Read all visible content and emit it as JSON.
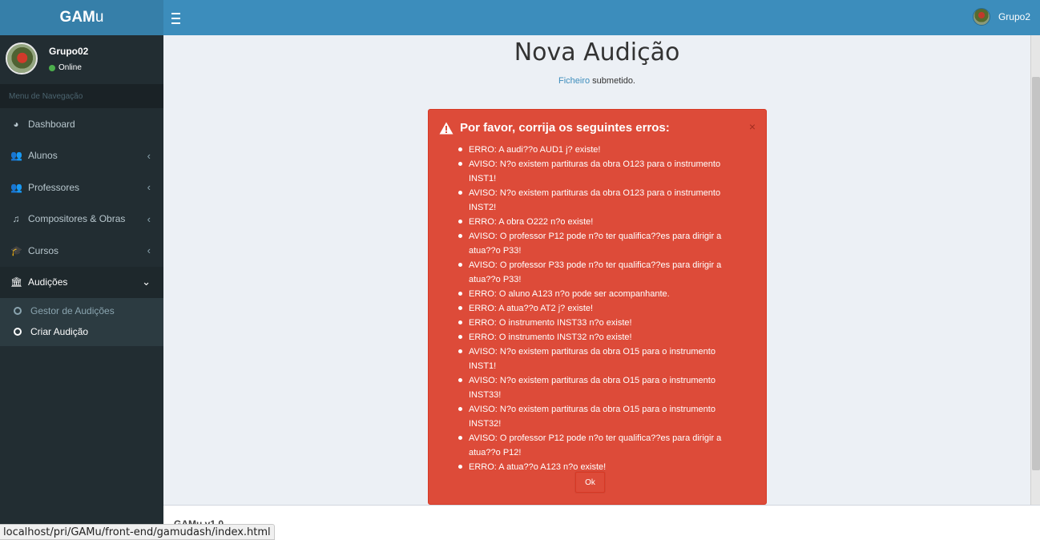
{
  "header": {
    "logo_bold": "GAM",
    "logo_light": "u",
    "user_name": "Grupo2"
  },
  "sidebar": {
    "user_name": "Grupo02",
    "user_status": "Online",
    "nav_header": "Menu de Navegação",
    "items": [
      {
        "label": "Dashboard",
        "icon": "dashboard-icon",
        "glyph": "◕"
      },
      {
        "label": "Alunos",
        "icon": "users-icon",
        "glyph": "👥"
      },
      {
        "label": "Professores",
        "icon": "users-icon",
        "glyph": "👥"
      },
      {
        "label": "Compositores & Obras",
        "icon": "music-icon",
        "glyph": "♫"
      },
      {
        "label": "Cursos",
        "icon": "graduation-cap-icon",
        "glyph": "🎓"
      },
      {
        "label": "Audições",
        "icon": "bank-icon",
        "glyph": "🏛"
      }
    ],
    "submenu": [
      {
        "label": "Gestor de Audições"
      },
      {
        "label": "Criar Audição"
      }
    ]
  },
  "content": {
    "title": "Nova Audição",
    "subtitle_link": "Ficheiro",
    "subtitle_text": " submetido."
  },
  "alert": {
    "heading": "Por favor, corrija os seguintes erros:",
    "close": "×",
    "ok_label": "Ok",
    "messages": [
      "ERRO: A audi??o AUD1 j? existe!",
      "AVISO: N?o existem partituras da obra O123 para o instrumento INST1!",
      "AVISO: N?o existem partituras da obra O123 para o instrumento INST2!",
      "ERRO: A obra O222 n?o existe!",
      "AVISO: O professor P12 pode n?o ter qualifica??es para dirigir a atua??o P33!",
      "AVISO: O professor P33 pode n?o ter qualifica??es para dirigir a atua??o P33!",
      "ERRO: O aluno A123 n?o pode ser acompanhante.",
      "ERRO: A atua??o AT2 j? existe!",
      "ERRO: O instrumento INST33 n?o existe!",
      "ERRO: O instrumento INST32 n?o existe!",
      "AVISO: N?o existem partituras da obra O15 para o instrumento INST1!",
      "AVISO: N?o existem partituras da obra O15 para o instrumento INST33!",
      "AVISO: N?o existem partituras da obra O15 para o instrumento INST32!",
      "AVISO: O professor P12 pode n?o ter qualifica??es para dirigir a atua??o P12!",
      "ERRO: A atua??o A123 n?o existe!"
    ]
  },
  "footer": {
    "version": "GAMu v1.0"
  },
  "status_url": "localhost/pri/GAMu/front-end/gamudash/index.html",
  "colors": {
    "primary": "#3c8dbc",
    "sidebar": "#222d32",
    "danger": "#dd4b39"
  }
}
